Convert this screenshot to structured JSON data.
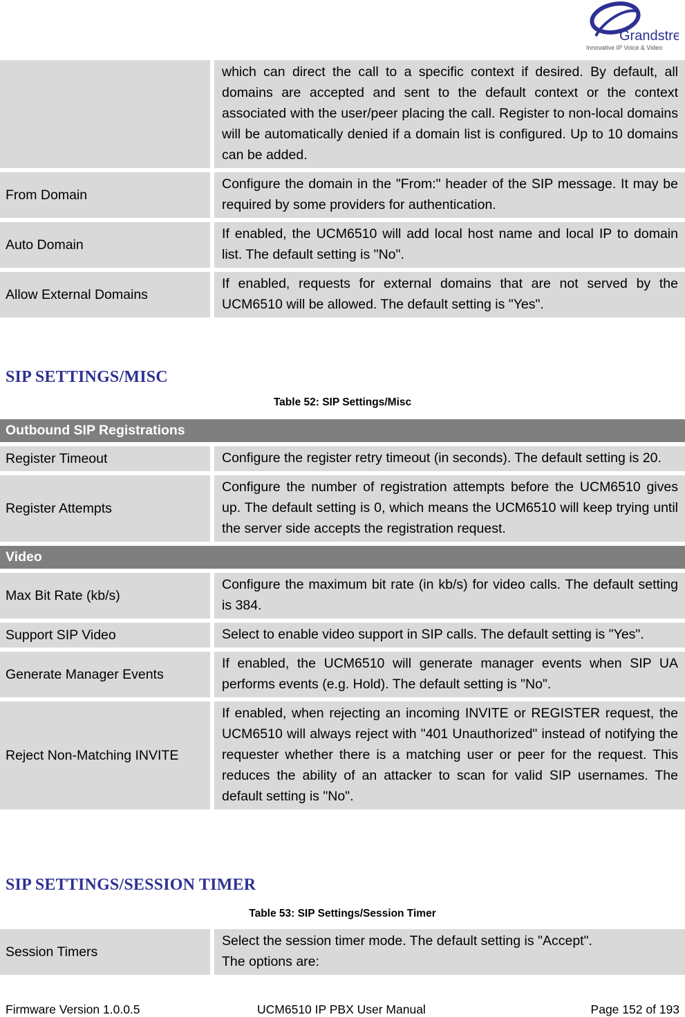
{
  "header": {
    "logo": {
      "brand": "Grandstream",
      "tagline": "Innovative IP Voice & Video"
    }
  },
  "table_top": {
    "rows": [
      {
        "label": "",
        "description": "which can direct the call to a specific context if desired. By default, all domains are accepted and sent to the default context or the context associated with the user/peer placing the call. Register to non-local domains will be automatically denied if a domain list is configured. Up to 10 domains can be added."
      },
      {
        "label": "From Domain",
        "description": "Configure the domain in the \"From:\" header of the SIP message. It may be required by some providers for authentication."
      },
      {
        "label": "Auto Domain",
        "description": "If enabled, the UCM6510 will add local host name and local IP to domain list. The default setting is \"No\"."
      },
      {
        "label": "Allow External Domains",
        "description": "If enabled, requests for external domains that are not served by the UCM6510 will be allowed. The default setting is \"Yes\"."
      }
    ]
  },
  "section_misc": {
    "title": "SIP SETTINGS/MISC",
    "caption": "Table 52: SIP Settings/Misc",
    "groups": [
      {
        "header": "Outbound SIP Registrations",
        "rows": [
          {
            "label": "Register Timeout",
            "description": "Configure the register retry timeout (in seconds). The default setting is 20."
          },
          {
            "label": "Register Attempts",
            "description": "Configure the number of registration attempts before the UCM6510 gives up. The default setting is 0, which means the UCM6510 will keep trying until the server side accepts the registration request."
          }
        ]
      },
      {
        "header": "Video",
        "rows": [
          {
            "label": "Max Bit Rate (kb/s)",
            "description": "Configure the maximum bit rate (in kb/s) for video calls. The default setting is 384."
          },
          {
            "label": "Support SIP Video",
            "description": "Select to enable video support in SIP calls. The default setting is \"Yes\"."
          },
          {
            "label": "Generate Manager Events",
            "description": "If enabled, the UCM6510 will generate manager events when SIP UA performs events (e.g. Hold). The default setting is \"No\"."
          },
          {
            "label": "Reject Non-Matching INVITE",
            "description": "If enabled, when rejecting an incoming INVITE or REGISTER request, the UCM6510 will always reject with \"401 Unauthorized\" instead of notifying the requester whether there is a matching user or peer for the request. This reduces the ability of an attacker to scan for valid SIP usernames. The default setting is \"No\"."
          }
        ]
      }
    ]
  },
  "section_session": {
    "title": "SIP SETTINGS/SESSION TIMER",
    "caption": "Table 53: SIP Settings/Session Timer",
    "rows": [
      {
        "label": "Session Timers",
        "description_lines": [
          "Select the session timer mode. The default setting is \"Accept\".",
          "The options are:"
        ]
      }
    ]
  },
  "footer": {
    "firmware": "Firmware Version 1.0.0.5",
    "manual": "UCM6510 IP PBX User Manual",
    "page": "Page 152 of 193"
  }
}
